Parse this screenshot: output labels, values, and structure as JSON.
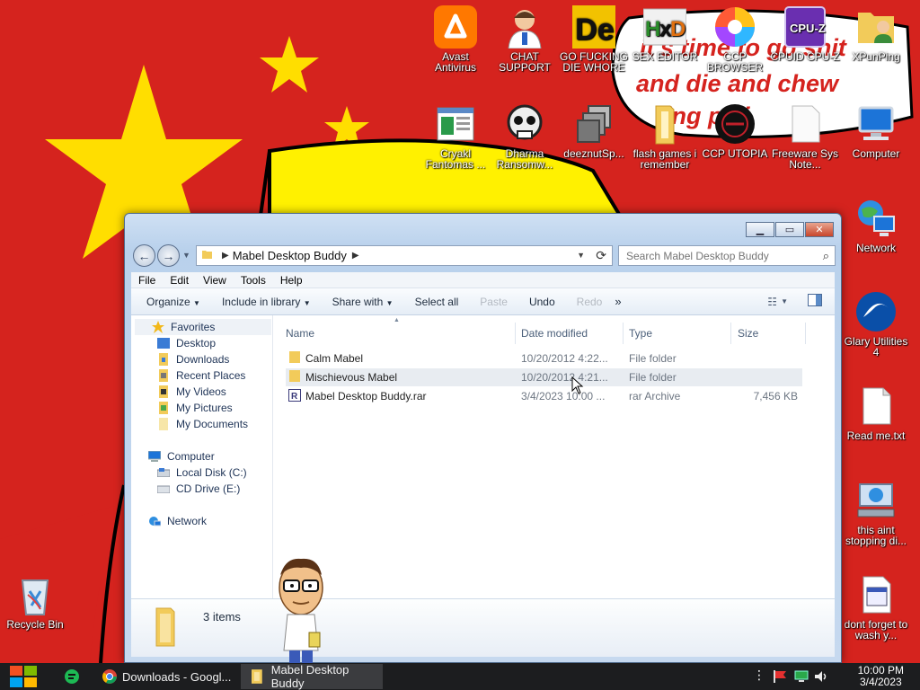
{
  "desktop": {
    "wallpaper_text": "it's time to go shit and die and chew ing pilli",
    "icons": [
      {
        "label": "Avast Antivirus",
        "icon": "avast-icon"
      },
      {
        "label": "CHAT SUPPORT",
        "icon": "support-agent-icon"
      },
      {
        "label": "GO FUCKING DIE WHORE",
        "icon": "de-app-icon"
      },
      {
        "label": "SEX EDITOR",
        "icon": "hxd-icon"
      },
      {
        "label": "CCP BROWSER",
        "icon": "browser-icon"
      },
      {
        "label": "CPUID CPU-Z",
        "icon": "cpuz-icon"
      },
      {
        "label": "XPunPing",
        "icon": "user-folder-icon"
      },
      {
        "label": "Cryakl Fantomas ...",
        "icon": "app-window-icon"
      },
      {
        "label": "Dharma Ransomw...",
        "icon": "skull-icon"
      },
      {
        "label": "deeznutSp...",
        "icon": "stacked-windows-icon"
      },
      {
        "label": "flash games i remember",
        "icon": "folder-icon"
      },
      {
        "label": "CCP UTOPIA",
        "icon": "dark-disc-icon"
      },
      {
        "label": "Freeware Sys Note...",
        "icon": "blank-doc-icon"
      },
      {
        "label": "Computer",
        "icon": "computer-icon"
      },
      {
        "label": "Network",
        "icon": "network-icon"
      },
      {
        "label": "Glary Utilities 4",
        "icon": "glary-icon"
      },
      {
        "label": "Read me.txt",
        "icon": "text-file-icon"
      },
      {
        "label": "this aint stopping di...",
        "icon": "network-drive-icon"
      },
      {
        "label": "dont forget to wash y...",
        "icon": "calendar-doc-icon"
      },
      {
        "label": "Recycle Bin",
        "icon": "recycle-bin-icon"
      }
    ]
  },
  "window": {
    "breadcrumb": "Mabel Desktop Buddy",
    "search_placeholder": "Search Mabel Desktop Buddy",
    "menu": [
      "File",
      "Edit",
      "View",
      "Tools",
      "Help"
    ],
    "commands": {
      "organize": "Organize",
      "include": "Include in library",
      "share": "Share with",
      "select_all": "Select all",
      "paste": "Paste",
      "undo": "Undo",
      "redo": "Redo",
      "more": "»"
    },
    "nav": {
      "favorites": "Favorites",
      "desktop": "Desktop",
      "downloads": "Downloads",
      "recent": "Recent Places",
      "videos": "My Videos",
      "pictures": "My Pictures",
      "documents": "My Documents",
      "computer": "Computer",
      "local_disk": "Local Disk (C:)",
      "cd_drive": "CD Drive (E:)",
      "network": "Network"
    },
    "columns": {
      "name": "Name",
      "date": "Date modified",
      "type": "Type",
      "size": "Size"
    },
    "files": [
      {
        "name": "Calm Mabel",
        "date": "10/20/2012 4:22...",
        "type": "File folder",
        "size": ""
      },
      {
        "name": "Mischievous Mabel",
        "date": "10/20/2012 4:21...",
        "type": "File folder",
        "size": ""
      },
      {
        "name": "Mabel Desktop Buddy.rar",
        "date": "3/4/2023 10:00 ...",
        "type": "rar Archive",
        "size": "7,456 KB"
      }
    ],
    "status": "3 items"
  },
  "taskbar": {
    "tasks": [
      {
        "label": "Downloads - Googl..."
      },
      {
        "label": "Mabel Desktop Buddy"
      }
    ],
    "clock_time": "10:00 PM",
    "clock_date": "3/4/2023"
  }
}
